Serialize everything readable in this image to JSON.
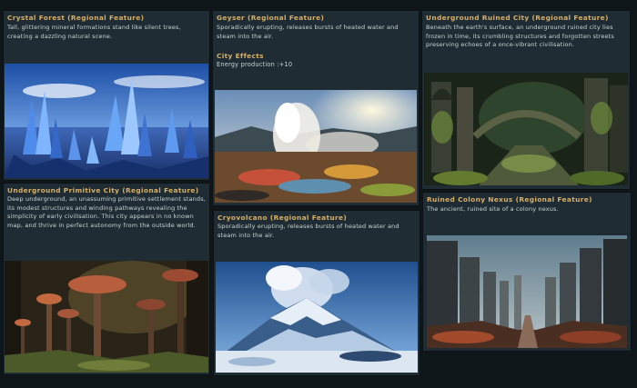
{
  "cards": [
    {
      "title": "Crystal Forest (Regional Feature)",
      "description": "Tall, glittering mineral formations stand like silent trees, creating a dazzling natural scene."
    },
    {
      "title": "Geyser (Regional Feature)",
      "description": "Sporadically erupting, releases bursts of heated water and steam into the air.",
      "effects_heading": "City Effects",
      "effect": "Energy production :+10"
    },
    {
      "title": "Underground Ruined City (Regional Feature)",
      "description": "Beneath the earth's surface, an underground ruined city lies frozen in time, its crumbling structures and forgotten streets preserving echoes of a once-vibrant civilisation."
    },
    {
      "title": "Underground Primitive City (Regional Feature)",
      "description": "Deep underground, an unassuming primitive settlement stands, its modest structures and winding pathways revealing the simplicity of early civilisation. This city appears in no known map, and thrive in perfect autonomy from the outside world."
    },
    {
      "title": "Cryovolcano (Regional Feature)",
      "description": "Sporadically erupting, releases bursts of heated water and steam into the air."
    },
    {
      "title": "Ruined Colony Nexus (Regional Feature)",
      "description": "The ancient, ruined site of a colony nexus."
    }
  ],
  "colors": {
    "background": "#0f1619",
    "card": "#1f2c33",
    "title": "#d8b066",
    "text": "#c9d4d8"
  }
}
